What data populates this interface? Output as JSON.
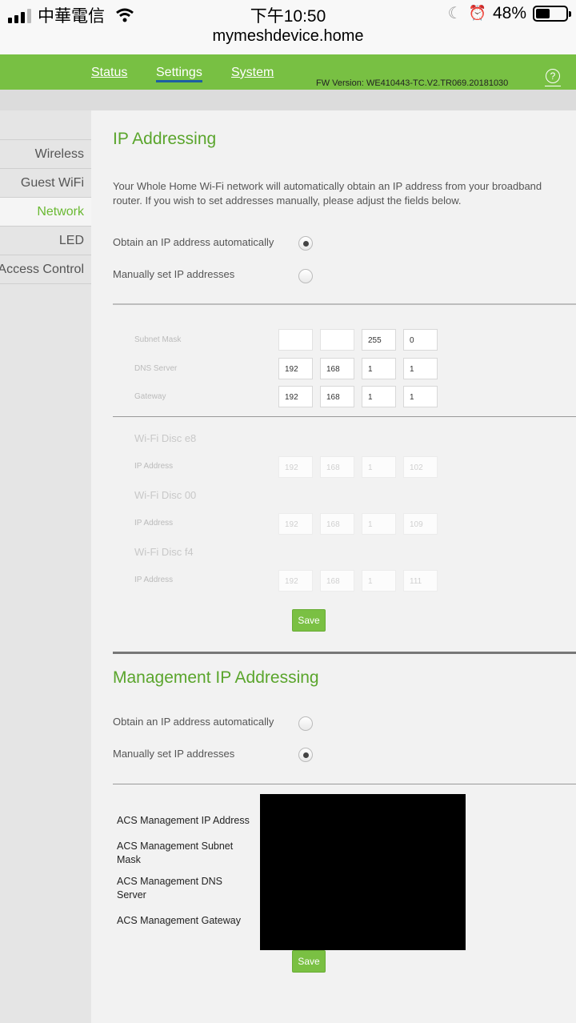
{
  "status_bar": {
    "carrier": "中華電信",
    "time": "下午10:50",
    "battery_percent": "48%",
    "battery_level": 0.48
  },
  "url_bar": {
    "url": "mymeshdevice.home"
  },
  "nav": {
    "tabs": [
      {
        "label": "Status",
        "active": false
      },
      {
        "label": "Settings",
        "active": true
      },
      {
        "label": "System",
        "active": false
      }
    ],
    "fw_version": "FW Version: WE410443-TC.V2.TR069.20181030",
    "help_symbol": "?"
  },
  "sidebar": {
    "items": [
      {
        "label": "Wireless",
        "active": false
      },
      {
        "label": "Guest WiFi",
        "active": false
      },
      {
        "label": "Network",
        "active": true
      },
      {
        "label": "LED",
        "active": false
      },
      {
        "label": "Access Control",
        "active": false
      }
    ]
  },
  "ip_addressing": {
    "title": "IP Addressing",
    "description_line1": "Your Whole Home Wi-Fi network will automatically obtain an IP address from your broadband",
    "description_line2": "router. If you wish to set addresses manually, please adjust the fields below.",
    "option_auto": "Obtain an IP address automatically",
    "option_manual": "Manually set IP addresses",
    "selected": "auto",
    "fields": [
      {
        "label": "Subnet Mask",
        "octets": [
          "",
          "",
          "255",
          "0"
        ]
      },
      {
        "label": "DNS Server",
        "octets": [
          "192",
          "168",
          "1",
          "1"
        ]
      },
      {
        "label": "Gateway",
        "octets": [
          "192",
          "168",
          "1",
          "1"
        ]
      }
    ],
    "discs": [
      {
        "name": "Wi-Fi Disc e8",
        "label": "IP Address",
        "octets": [
          "192",
          "168",
          "1",
          "102"
        ]
      },
      {
        "name": "Wi-Fi Disc 00",
        "label": "IP Address",
        "octets": [
          "192",
          "168",
          "1",
          "109"
        ]
      },
      {
        "name": "Wi-Fi Disc f4",
        "label": "IP Address",
        "octets": [
          "192",
          "168",
          "1",
          "111"
        ]
      }
    ],
    "save_label": "Save"
  },
  "management": {
    "title": "Management IP Addressing",
    "option_auto": "Obtain an IP address automatically",
    "option_manual": "Manually set IP addresses",
    "selected": "manual",
    "fields": [
      "ACS Management IP Address",
      "ACS Management Subnet Mask",
      "ACS Management DNS Server",
      "ACS Management Gateway"
    ],
    "save_label": "Save"
  },
  "icons": {
    "wifi": "wifi-icon",
    "moon": "moon-icon",
    "alarm": "alarm-icon",
    "battery": "battery-icon",
    "help": "help-icon"
  },
  "colors": {
    "brand_green": "#78c043",
    "heading_green": "#5aa52c",
    "active_tab_underline": "#1d5fa3"
  }
}
